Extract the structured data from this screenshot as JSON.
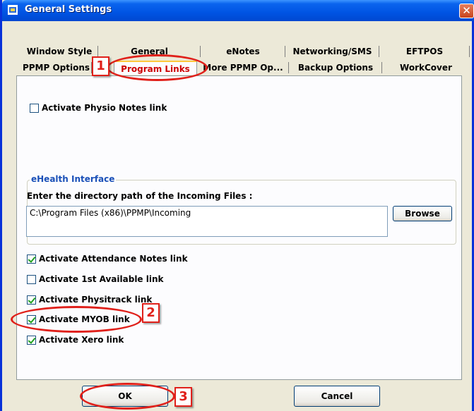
{
  "window": {
    "title": "General Settings",
    "close_glyph": "✕"
  },
  "tabs": {
    "row1": [
      "Window Style",
      "General",
      "eNotes",
      "Networking/SMS",
      "EFTPOS"
    ],
    "row2": [
      "PPMP Options",
      "Program Links",
      "More PPMP Op...",
      "Backup Options",
      "WorkCover"
    ],
    "active": "Program Links"
  },
  "panel": {
    "physio_notes": {
      "label": "Activate Physio Notes link",
      "checked": false
    },
    "ehealth": {
      "group_title": "eHealth Interface",
      "dir_label": "Enter the directory path of the Incoming Files :",
      "dir_value": "C:\\Program Files (x86)\\PPMP\\Incoming",
      "browse_label": "Browse"
    },
    "links": [
      {
        "label": "Activate Attendance Notes link",
        "checked": true
      },
      {
        "label": "Activate 1st Available link",
        "checked": false
      },
      {
        "label": "Activate Physitrack link",
        "checked": true
      },
      {
        "label": "Activate MYOB link",
        "checked": true
      },
      {
        "label": "Activate Xero link",
        "checked": true
      }
    ]
  },
  "footer": {
    "ok_label": "OK",
    "cancel_label": "Cancel"
  },
  "callouts": [
    "1",
    "2",
    "3"
  ],
  "colors": {
    "titlebar": "#0054e3",
    "callout": "#e0201a",
    "group_title": "#1a50b8",
    "check": "#21a121"
  }
}
